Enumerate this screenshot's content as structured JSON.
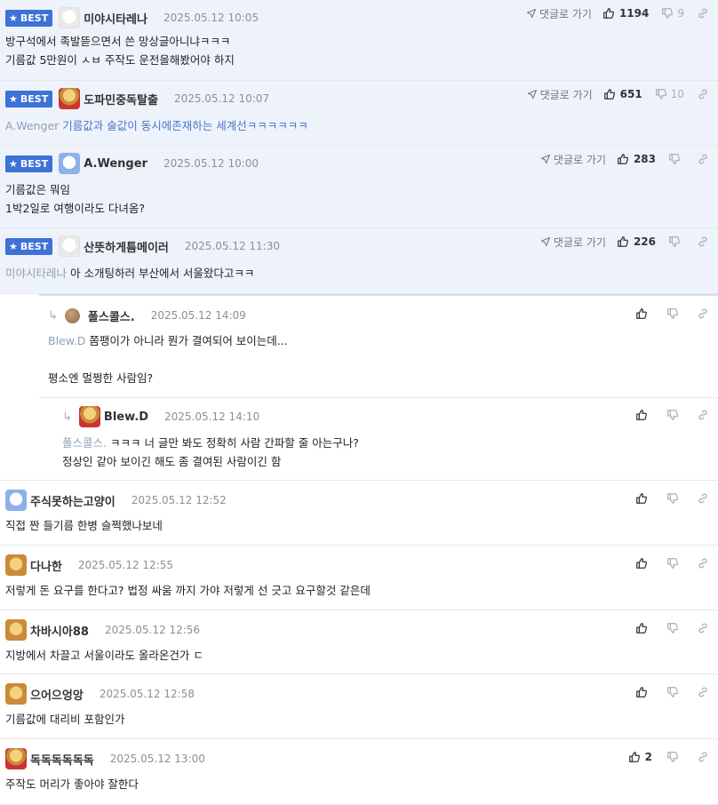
{
  "labels": {
    "best": "BEST",
    "goto_reply": "댓글로 가기"
  },
  "colors": {
    "best_bg": "#eef3fb",
    "badge": "#3d72d6",
    "mention_blue": "#4a76c9"
  },
  "comments": [
    {
      "nick": "미야시타레나",
      "date": "2025.05.12 10:05",
      "likes": "1194",
      "dislikes": "9",
      "lines": [
        "방구석에서 족발뜯으면서 쓴 망상글아니냐ㅋㅋㅋ",
        "기름값 5만원이 ㅅㅂ 주작도 운전을해봤어야 하지"
      ]
    },
    {
      "nick": "도파민중독탈출",
      "date": "2025.05.12 10:07",
      "likes": "651",
      "dislikes": "10",
      "mention": "A.Wenger",
      "text": "기름값과 술값이 동시에존재하는 세계선ㅋㅋㅋㅋㅋㅋ"
    },
    {
      "nick": "A.Wenger",
      "date": "2025.05.12 10:00",
      "likes": "283",
      "lines": [
        "기름값은 뭐임",
        "1박2일로 여행이라도 다녀옴?"
      ]
    },
    {
      "nick": "산뜻하게틈메이러",
      "date": "2025.05.12 11:30",
      "likes": "226",
      "mention": "미야시타레나",
      "text": "아 소개팅하러 부산에서 서울왔다고ㅋㅋ"
    },
    {
      "nick": "폴스콜스.",
      "date": "2025.05.12 14:09",
      "mention": "Blew.D",
      "text": "쫌팽이가 아니라 뭔가 결여되어 보이는데...",
      "line2": "평소엔 멀쩡한 사람임?"
    },
    {
      "nick": "Blew.D",
      "date": "2025.05.12 14:10",
      "mention": "폴스콜스.",
      "text": "ㅋㅋㅋ 너 글만 봐도 정확히 사람 간파할 줄 아는구나?",
      "line2": "정상인 같아 보이긴 해도 좀 결여된 사람이긴 함"
    },
    {
      "nick": "주식못하는고양이",
      "date": "2025.05.12 12:52",
      "text": "직접 짠 들기름 한병 슬쩍했나보네"
    },
    {
      "nick": "다나한",
      "date": "2025.05.12 12:55",
      "text": "저렇게 돈 요구를 한다고? 법정 싸움 까지 가야 저렇게 선 긋고 요구할것 같은데"
    },
    {
      "nick": "차바시아88",
      "date": "2025.05.12 12:56",
      "text": "지방에서 차끌고 서울이라도 올라온건가 ㄷ"
    },
    {
      "nick": "으어으엉앙",
      "date": "2025.05.12 12:58",
      "text": "기름값에 대리비 포함인가"
    },
    {
      "nick": "독독독독독독",
      "date": "2025.05.12 13:00",
      "likes": "2",
      "text": "주작도 머리가 좋아야 잘한다"
    }
  ]
}
